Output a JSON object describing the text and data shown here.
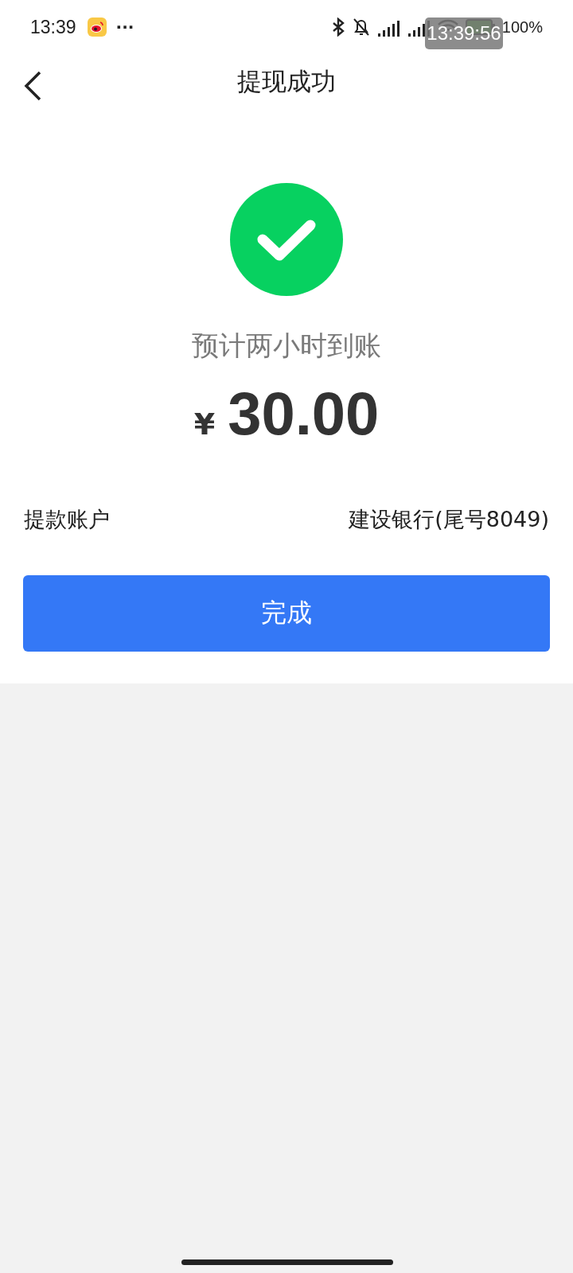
{
  "status_bar": {
    "time": "13:39",
    "more": "···",
    "battery": "100%",
    "overlay_clock": "13:39:56"
  },
  "nav": {
    "title": "提现成功"
  },
  "result": {
    "message": "预计两小时到账",
    "currency": "¥",
    "amount": "30.00"
  },
  "account": {
    "label": "提款账户",
    "value": "建设银行(尾号8049)"
  },
  "done_button": "完成"
}
